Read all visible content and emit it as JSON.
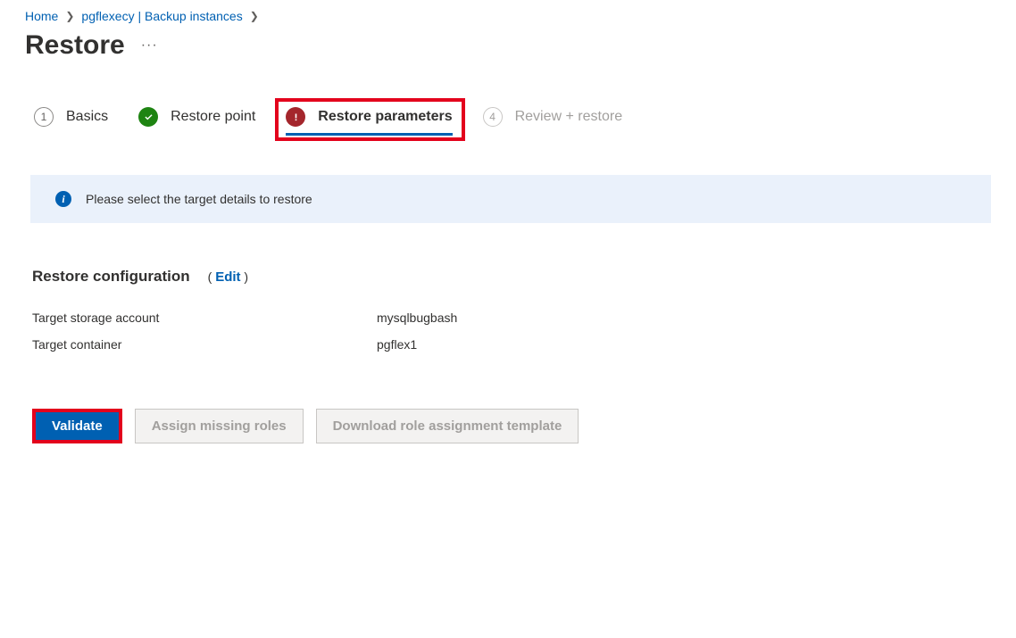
{
  "breadcrumb": {
    "home": "Home",
    "level1": "pgflexecy | Backup instances"
  },
  "page_title": "Restore",
  "steps": {
    "s1": {
      "num": "1",
      "label": "Basics"
    },
    "s2": {
      "label": "Restore point"
    },
    "s3": {
      "label": "Restore parameters"
    },
    "s4": {
      "num": "4",
      "label": "Review + restore"
    }
  },
  "info_banner": "Please select the target details to restore",
  "config": {
    "heading": "Restore configuration",
    "edit": "Edit",
    "rows": {
      "storage_label": "Target storage account",
      "storage_value": "mysqlbugbash",
      "container_label": "Target container",
      "container_value": "pgflex1"
    }
  },
  "buttons": {
    "validate": "Validate",
    "assign": "Assign missing roles",
    "download": "Download role assignment template"
  }
}
